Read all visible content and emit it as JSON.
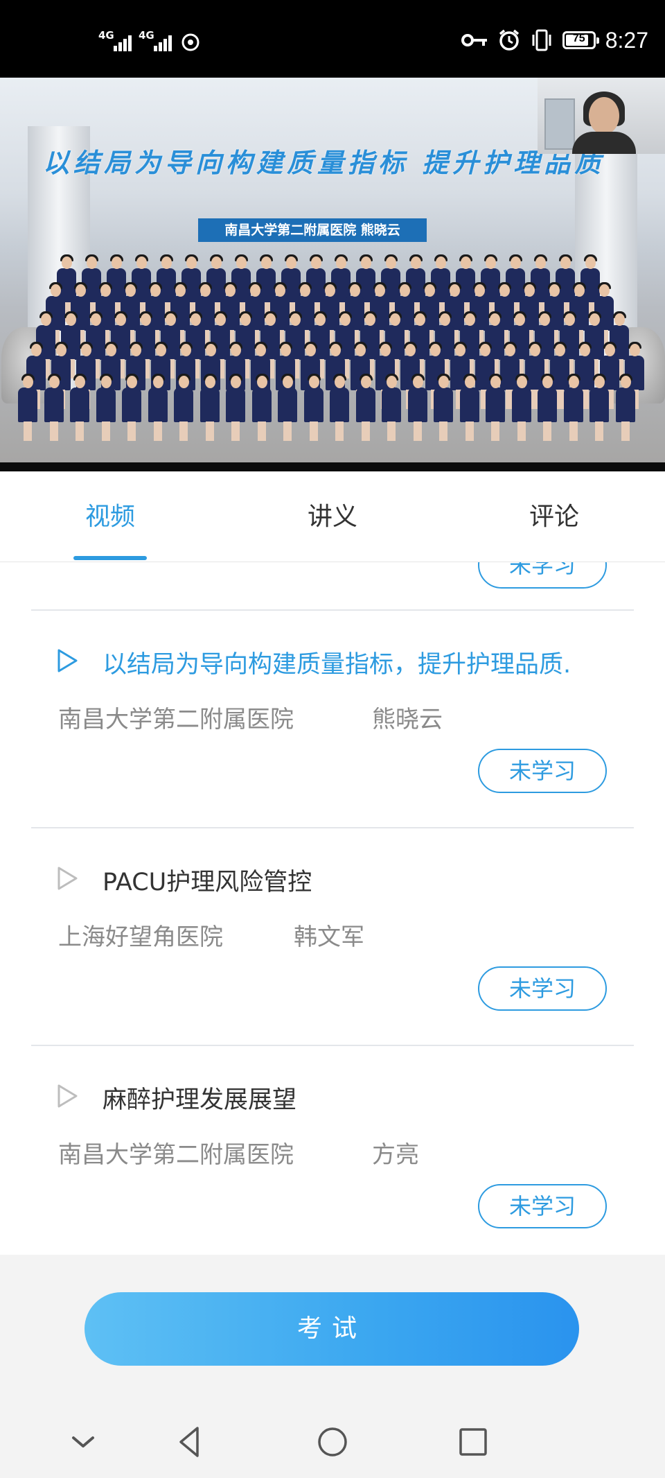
{
  "status_bar": {
    "network_1": "4G",
    "network_2": "4G",
    "battery": "75",
    "time": "8:27"
  },
  "video": {
    "slide_title": "以结局为导向构建质量指标  提升护理品质",
    "slide_subtitle": "南昌大学第二附属医院  熊晓云"
  },
  "tabs": [
    {
      "label": "视频",
      "active": true
    },
    {
      "label": "讲义",
      "active": false
    },
    {
      "label": "评论",
      "active": false
    }
  ],
  "list": {
    "partial_status": "未学习",
    "items": [
      {
        "title": "以结局为导向构建质量指标，提升护理品质.",
        "hospital": "南昌大学第二附属医院",
        "author": "熊晓云",
        "status": "未学习",
        "active": true
      },
      {
        "title": "PACU护理风险管控",
        "hospital": "上海好望角医院",
        "author": "韩文军",
        "status": "未学习",
        "active": false
      },
      {
        "title": "麻醉护理发展展望",
        "hospital": "南昌大学第二附属医院",
        "author": "方亮",
        "status": "未学习",
        "active": false
      }
    ]
  },
  "exam_button": "考试",
  "colors": {
    "accent": "#2d9be0",
    "text": "#333333",
    "secondary_text": "#8a8a8a",
    "exam_gradient_start": "#5ec0f4",
    "exam_gradient_end": "#2a93ee"
  },
  "icons": {
    "play": "play-outline-icon",
    "nav": [
      "chevron-down-icon",
      "back-triangle-icon",
      "home-circle-icon",
      "recents-square-icon"
    ]
  }
}
